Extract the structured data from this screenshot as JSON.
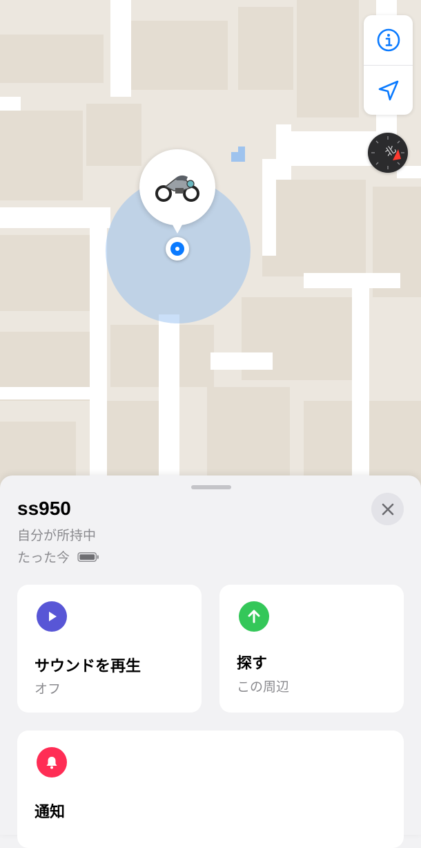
{
  "map": {
    "controls": {
      "info_icon": "info-icon",
      "location_icon": "location-arrow-icon"
    },
    "compass_icon": "compass-icon",
    "device_pin_icon": "motorcycle-icon",
    "accent_color": "#0a7aff",
    "accuracy_color": "#8ab7f0"
  },
  "sheet": {
    "title": "ss950",
    "subtitle": "自分が所持中",
    "time": "たった今",
    "battery_icon": "battery-icon",
    "close_icon": "close-icon"
  },
  "actions": {
    "sound": {
      "label": "サウンドを再生",
      "sublabel": "オフ",
      "icon": "play-icon",
      "color": "#5856d6"
    },
    "find": {
      "label": "探す",
      "sublabel": "この周辺",
      "icon": "arrow-up-icon",
      "color": "#34c759"
    },
    "notify": {
      "label": "通知",
      "icon": "bell-icon",
      "color": "#ff2d55"
    }
  }
}
